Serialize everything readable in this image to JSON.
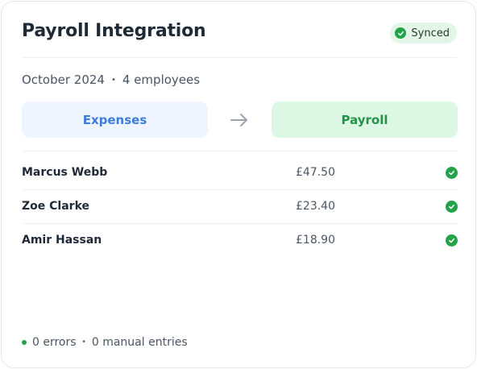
{
  "header": {
    "title": "Payroll Integration",
    "status_badge": "Synced",
    "status_color": "#22a34a"
  },
  "meta": {
    "period": "October 2024",
    "separator": "•",
    "employees": "4 employees"
  },
  "flow": {
    "source": "Expenses",
    "target": "Payroll",
    "source_color": "#3b7dd8",
    "target_color": "#249247"
  },
  "rows": [
    {
      "name": "Marcus Webb",
      "amount": "£47.50",
      "status_icon": "check-circle-icon"
    },
    {
      "name": "Zoe Clarke",
      "amount": "£23.40",
      "status_icon": "check-circle-icon"
    },
    {
      "name": "Amir Hassan",
      "amount": "£18.90",
      "status_icon": "check-circle-icon"
    }
  ],
  "footer": {
    "errors": "0 errors",
    "separator": "•",
    "manual": "0 manual entries"
  }
}
